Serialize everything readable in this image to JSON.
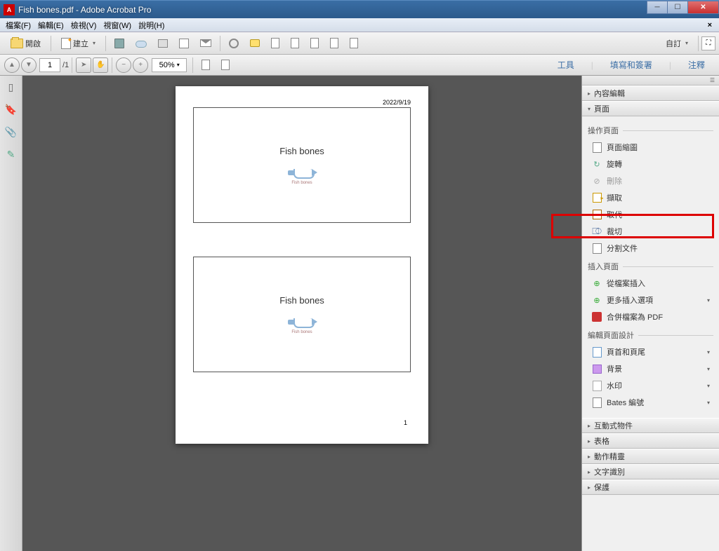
{
  "window": {
    "title": "Fish bones.pdf - Adobe Acrobat Pro"
  },
  "menu": {
    "file": "檔案(F)",
    "edit": "編輯(E)",
    "view": "檢視(V)",
    "window": "視窗(W)",
    "help": "說明(H)"
  },
  "toolbar": {
    "open": "開啟",
    "create": "建立",
    "custom": "自訂"
  },
  "nav": {
    "page": "1",
    "total": "/1",
    "zoom": "50%"
  },
  "rightlinks": {
    "tools": "工具",
    "fill": "填寫和簽署",
    "comment": "注釋"
  },
  "doc": {
    "date": "2022/9/19",
    "slide_title": "Fish bones",
    "logo_sub": "Fish bones",
    "page_num": "1"
  },
  "panel": {
    "content_edit": "內容編輯",
    "page": "頁面",
    "sec_manipulate": "操作頁面",
    "thumb": "頁面縮圖",
    "rotate": "旋轉",
    "delete": "刪除",
    "extract": "擷取",
    "replace": "取代",
    "crop": "裁切",
    "split": "分割文件",
    "sec_insert": "插入頁面",
    "from_file": "從檔案插入",
    "more_insert": "更多插入選項",
    "merge": "合併檔案為 PDF",
    "sec_design": "編輯頁面設計",
    "header_footer": "頁首和頁尾",
    "background": "背景",
    "watermark": "水印",
    "bates": "Bates 編號",
    "interactive": "互動式物件",
    "forms": "表格",
    "action": "動作精靈",
    "ocr": "文字識別",
    "protect": "保護"
  }
}
